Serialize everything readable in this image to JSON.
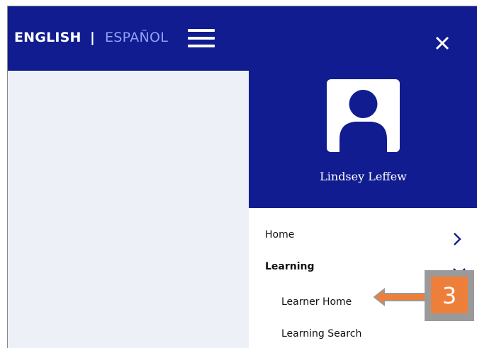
{
  "header": {
    "lang_english": "ENGLISH",
    "lang_separator": "|",
    "lang_spanish": "ESPAÑOL",
    "menu_icon": "hamburger-icon",
    "close_icon": "close-icon"
  },
  "profile": {
    "avatar_icon": "user-avatar-icon",
    "name": "Lindsey Leffew"
  },
  "menu": {
    "items": [
      {
        "label": "Home",
        "icon": "chevron-right-icon"
      },
      {
        "label": "Learning",
        "icon": "chevron-down-icon"
      },
      {
        "label": "Learner Home"
      },
      {
        "label": "Learning Search"
      }
    ]
  },
  "annotation": {
    "step_number": "3",
    "arrow_icon": "left-arrow-icon"
  },
  "colors": {
    "header_bg": "#101c8f",
    "page_bg": "#eef0f8",
    "accent_link": "#8fa3f5",
    "annotation_orange": "#ee7f3a",
    "annotation_gray": "#9a9a9a"
  }
}
